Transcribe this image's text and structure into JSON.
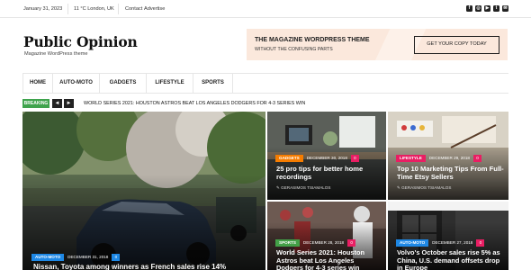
{
  "topbar": {
    "date": "January 31, 2023",
    "weather": "11 °C London, UK",
    "links": [
      "Contact",
      "Advertise"
    ],
    "socials": [
      "facebook-icon",
      "instagram-icon",
      "youtube-icon",
      "twitter-icon",
      "mail-icon"
    ]
  },
  "header": {
    "logo": "Public Opinion",
    "tagline": "Magazine WordPress theme"
  },
  "ad": {
    "title": "THE MAGAZINE WORDPRESS THEME",
    "subtitle": "WITHOUT THE CONFUSING PARTS",
    "button": "GET YOUR COPY TODAY"
  },
  "nav": {
    "items": [
      "HOME",
      "AUTO-MOTO",
      "GADGETS",
      "LIFESTYLE",
      "SPORTS"
    ]
  },
  "breaking": {
    "label": "BREAKING",
    "prev": "◄",
    "next": "►",
    "headline": "WORLD SERIES 2021: HOUSTON ASTROS BEAT LOS ANGELES DODGERS FOR 4-3 SERIES WIN"
  },
  "colors": {
    "auto": "#1e88e5",
    "gadgets": "#f57c00",
    "lifestyle": "#e91e63",
    "sports": "#43a047",
    "comment_pink": "#e91e63",
    "comment_blue": "#1e88e5",
    "breaking": "#3fa34d"
  },
  "posts": {
    "main": {
      "category": "AUTO-MOTO",
      "date": "DECEMBER 31, 2018",
      "comments": "0",
      "title": "Nissan, Toyota among winners as French sales rise 14%"
    },
    "p1": {
      "category": "GADGETS",
      "date": "DECEMBER 30, 2018",
      "comments": "0",
      "title": "25 pro tips for better home recordings",
      "author": "GERASIMOS TSIAMALOS"
    },
    "p2": {
      "category": "LIFESTYLE",
      "date": "DECEMBER 29, 2018",
      "comments": "0",
      "title": "Top 10 Marketing Tips From Full-Time Etsy Sellers",
      "author": "GERASIMOS TSIAMALOS"
    },
    "p3": {
      "category": "SPORTS",
      "date": "DECEMBER 28, 2018",
      "comments": "0",
      "title": "World Series 2021: Houston Astros beat Los Angeles Dodgers for 4-3 series win"
    },
    "p4": {
      "category": "AUTO-MOTO",
      "date": "DECEMBER 27, 2018",
      "comments": "0",
      "title": "Volvo's October sales rise 5% as China, U.S. demand offsets drop in Europe"
    }
  }
}
